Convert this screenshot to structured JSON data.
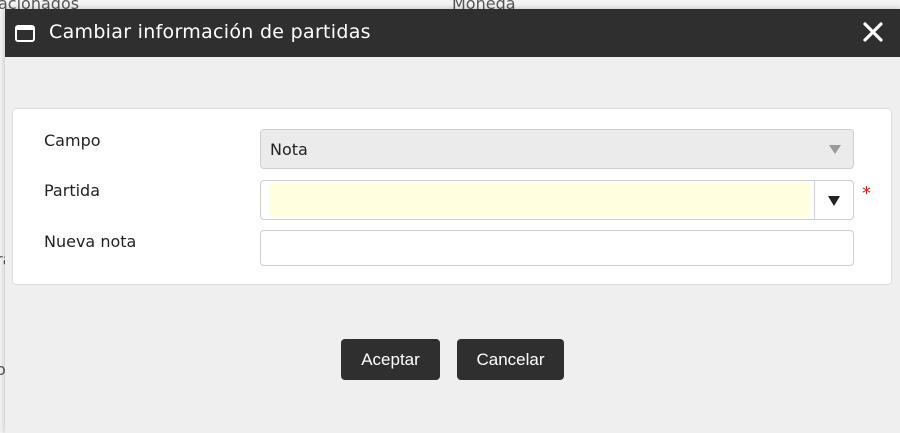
{
  "background": {
    "left_column_fragment": "acionados",
    "right_column_fragment": "Moneda",
    "fragment_1": "ra",
    "fragment_2": "o"
  },
  "dialog": {
    "title": "Cambiar información de partidas",
    "title_icon": "window-icon",
    "close_icon": "close-icon"
  },
  "form": {
    "campo": {
      "label": "Campo",
      "selected": "Nota"
    },
    "partida": {
      "label": "Partida",
      "value": "",
      "required_mark": "*"
    },
    "nueva_nota": {
      "label": "Nueva nota",
      "value": "",
      "placeholder": ""
    }
  },
  "buttons": {
    "accept_label": "Aceptar",
    "cancel_label": "Cancelar"
  },
  "colors": {
    "titlebar": "#2f2f2f",
    "dialog_bg": "#efefef",
    "required": "#e02020",
    "partida_field": "#ffffe0"
  }
}
